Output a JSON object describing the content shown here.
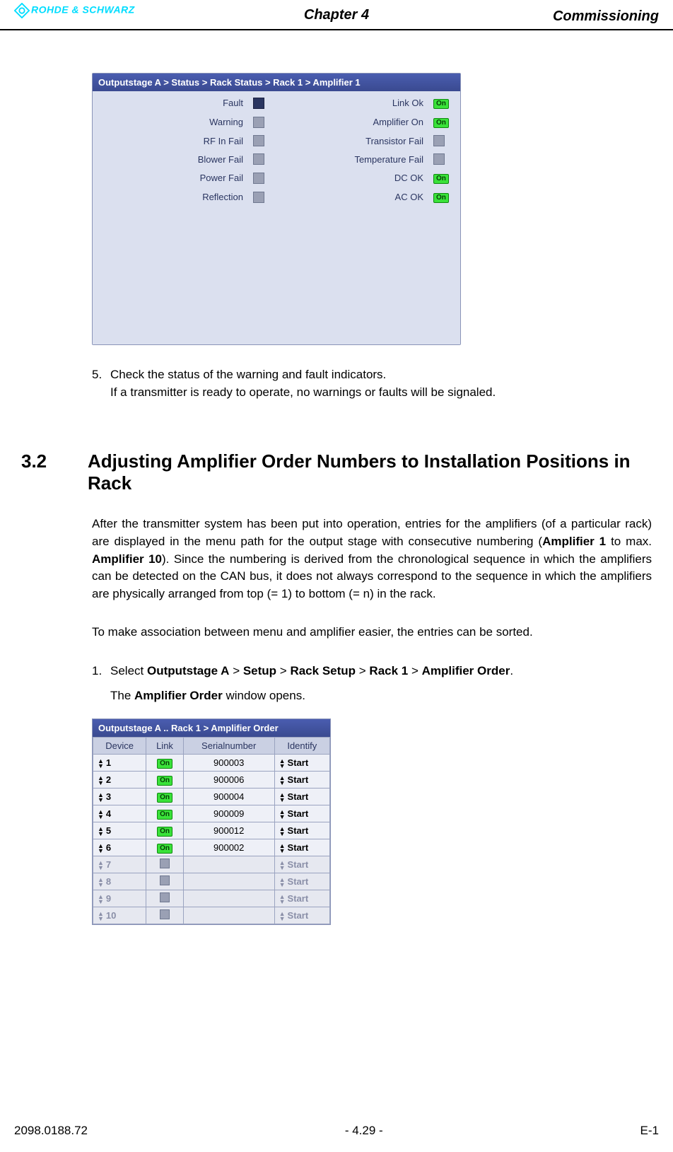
{
  "header": {
    "brand": "ROHDE & SCHWARZ",
    "chapter": "Chapter 4",
    "section_title": "Commissioning"
  },
  "panel1": {
    "breadcrumb": "Outputstage A  > Status > Rack Status > Rack 1 > Amplifier 1",
    "on_text": "On",
    "left": [
      {
        "label": "Fault",
        "state": "sel"
      },
      {
        "label": "Warning",
        "state": "off"
      },
      {
        "label": "RF In Fail",
        "state": "off"
      },
      {
        "label": "Blower Fail",
        "state": "off"
      },
      {
        "label": "Power Fail",
        "state": "off"
      },
      {
        "label": "Reflection",
        "state": "off"
      }
    ],
    "right": [
      {
        "label": "Link Ok",
        "state": "on"
      },
      {
        "label": "Amplifier On",
        "state": "on"
      },
      {
        "label": "Transistor Fail",
        "state": "off"
      },
      {
        "label": "Temperature Fail",
        "state": "off"
      },
      {
        "label": "DC OK",
        "state": "on"
      },
      {
        "label": "AC OK",
        "state": "on"
      }
    ]
  },
  "step5": {
    "num": "5.",
    "line1": "Check the status of the warning and fault indicators.",
    "line2": "If a transmitter is ready to operate, no warnings or faults will be signaled."
  },
  "section32": {
    "num": "3.2",
    "title": "Adjusting Amplifier Order Numbers to Installation Positions in Rack"
  },
  "para1_parts": {
    "p0": "After the transmitter system has been put into operation, entries for the amplifiers (of a particular rack) are displayed in the menu path for the output stage with consecutive numbering (",
    "b1": "Amplifier 1",
    "p1": " to max. ",
    "b2": "Amplifier 10",
    "p2": "). Since the numbering is derived from the chronological sequence in which the amplifiers can be detected on the CAN bus, it does not always correspond to the sequence in which the amplifiers are physically arranged from top (= 1) to bottom (= n) in the rack."
  },
  "para2": "To make association between menu and amplifier easier, the entries can be sorted.",
  "step1": {
    "num": "1.",
    "pre": "Select ",
    "p1": "Outputstage A",
    "s1": " > ",
    "p2": "Setup",
    "s2": " > ",
    "p3": "Rack Setup",
    "s3": " > ",
    "p4": "Rack 1",
    "s4": " > ",
    "p5": "Amplifier Order",
    "post": ".",
    "line2_pre": "The ",
    "line2_b": "Amplifier Order",
    "line2_post": " window opens."
  },
  "panel2": {
    "title": "Outputstage A .. Rack 1 > Amplifier Order",
    "headers": {
      "device": "Device",
      "link": "Link",
      "serial": "Serialnumber",
      "identify": "Identify"
    },
    "on_text": "On",
    "identify_label": "Start",
    "rows": [
      {
        "device": "1",
        "link": "on",
        "serial": "900003",
        "enabled": true
      },
      {
        "device": "2",
        "link": "on",
        "serial": "900006",
        "enabled": true
      },
      {
        "device": "3",
        "link": "on",
        "serial": "900004",
        "enabled": true
      },
      {
        "device": "4",
        "link": "on",
        "serial": "900009",
        "enabled": true
      },
      {
        "device": "5",
        "link": "on",
        "serial": "900012",
        "enabled": true
      },
      {
        "device": "6",
        "link": "on",
        "serial": "900002",
        "enabled": true
      },
      {
        "device": "7",
        "link": "off",
        "serial": "",
        "enabled": false
      },
      {
        "device": "8",
        "link": "off",
        "serial": "",
        "enabled": false
      },
      {
        "device": "9",
        "link": "off",
        "serial": "",
        "enabled": false
      },
      {
        "device": "10",
        "link": "off",
        "serial": "",
        "enabled": false
      }
    ]
  },
  "footer": {
    "left": "2098.0188.72",
    "center": "- 4.29 -",
    "right": "E-1"
  }
}
